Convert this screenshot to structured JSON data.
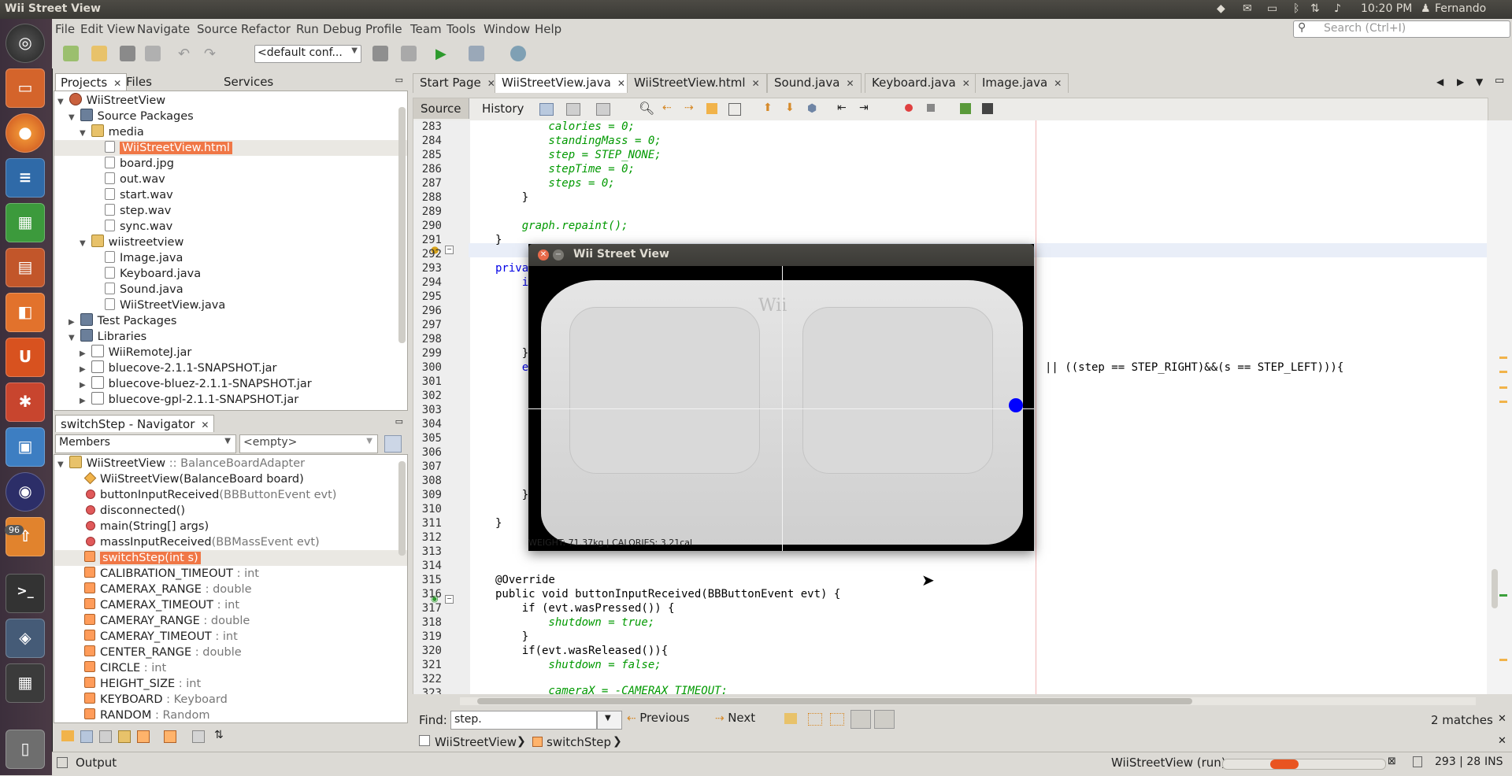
{
  "window": {
    "title": "Wii Street View"
  },
  "tray": {
    "time": "10:20 PM",
    "user": "Fernando"
  },
  "launcher": {
    "badge": "96"
  },
  "menu": [
    "File",
    "Edit",
    "View",
    "Navigate",
    "Source",
    "Refactor",
    "Run",
    "Debug",
    "Profile",
    "Team",
    "Tools",
    "Window",
    "Help"
  ],
  "search": {
    "placeholder": "Search (Ctrl+I)"
  },
  "toolbar": {
    "config": "<default conf..."
  },
  "projects_panel": {
    "tabs": [
      "Projects",
      "Files",
      "Services"
    ],
    "tree": [
      {
        "label": "WiiStreetView"
      },
      {
        "label": "Source Packages"
      },
      {
        "label": "media"
      },
      {
        "label": "WiiStreetView.html"
      },
      {
        "label": "board.jpg"
      },
      {
        "label": "out.wav"
      },
      {
        "label": "start.wav"
      },
      {
        "label": "step.wav"
      },
      {
        "label": "sync.wav"
      },
      {
        "label": "wiistreetview"
      },
      {
        "label": "Image.java"
      },
      {
        "label": "Keyboard.java"
      },
      {
        "label": "Sound.java"
      },
      {
        "label": "WiiStreetView.java"
      },
      {
        "label": "Test Packages"
      },
      {
        "label": "Libraries"
      },
      {
        "label": "WiiRemoteJ.jar"
      },
      {
        "label": "bluecove-2.1.1-SNAPSHOT.jar"
      },
      {
        "label": "bluecove-bluez-2.1.1-SNAPSHOT.jar"
      },
      {
        "label": "bluecove-gpl-2.1.1-SNAPSHOT.jar"
      }
    ]
  },
  "navigator": {
    "title": "switchStep - Navigator",
    "members_label": "Members",
    "filter_value": "<empty>",
    "class_name": "WiiStreetView",
    "class_super": " :: BalanceBoardAdapter",
    "members": [
      {
        "name": "WiiStreetView",
        "sig": "(BalanceBoard board)"
      },
      {
        "name": "buttonInputReceived",
        "sig": "(BBButtonEvent evt)"
      },
      {
        "name": "disconnected",
        "sig": "()"
      },
      {
        "name": "main",
        "sig": "(String[] args)"
      },
      {
        "name": "massInputReceived",
        "sig": "(BBMassEvent evt)"
      },
      {
        "name": "switchStep(int s)",
        "sig": ""
      },
      {
        "name": "CALIBRATION_TIMEOUT",
        "sig": " : int"
      },
      {
        "name": "CAMERAX_RANGE",
        "sig": " : double"
      },
      {
        "name": "CAMERAX_TIMEOUT",
        "sig": " : int"
      },
      {
        "name": "CAMERAY_RANGE",
        "sig": " : double"
      },
      {
        "name": "CAMERAY_TIMEOUT",
        "sig": " : int"
      },
      {
        "name": "CENTER_RANGE",
        "sig": " : double"
      },
      {
        "name": "CIRCLE",
        "sig": " : int"
      },
      {
        "name": "HEIGHT_SIZE",
        "sig": " : int"
      },
      {
        "name": "KEYBOARD",
        "sig": " : Keyboard"
      },
      {
        "name": "RANDOM",
        "sig": " : Random"
      }
    ]
  },
  "editor": {
    "tabs": [
      "Start Page",
      "WiiStreetView.java",
      "WiiStreetView.html",
      "Sound.java",
      "Keyboard.java",
      "Image.java"
    ],
    "source_label": "Source",
    "history_label": "History",
    "line_numbers": [
      "283",
      "284",
      "285",
      "286",
      "287",
      "288",
      "289",
      "290",
      "291",
      "292",
      "293",
      "294",
      "295",
      "296",
      "297",
      "298",
      "299",
      "300",
      "301",
      "302",
      "303",
      "304",
      "305",
      "306",
      "307",
      "308",
      "309",
      "310",
      "311",
      "312",
      "313",
      "314",
      "315",
      "316",
      "317",
      "318",
      "319",
      "320",
      "321",
      "322",
      "323"
    ],
    "code": {
      "l283": "        calories = 0;",
      "l284": "        standingMass = 0;",
      "l285": "        step = STEP_NONE;",
      "l286": "        stepTime = 0;",
      "l287": "        steps = 0;",
      "l288": "    }",
      "l290": "    graph.repaint();",
      "l291": "}",
      "l293": "priva",
      "l294": "    i",
      "l299": "    }",
      "l300a": "    e",
      "l300b": "|| ((step == STEP_RIGHT)&&(s == STEP_LEFT))){",
      "l309": "    }",
      "l311": "}",
      "l315": "@Override",
      "l316": "public void buttonInputReceived(BBButtonEvent evt) {",
      "l317": "    if (evt.wasPressed()) {",
      "l318": "        shutdown = true;",
      "l319": "    }",
      "l320": "    if(evt.wasReleased()){",
      "l321": "        shutdown = false;",
      "l323": "        cameraX = -CAMERAX_TIMEOUT;"
    }
  },
  "wii_window": {
    "title": "Wii Street View",
    "status": "WEIGHT: 71.37kg | CALORIES: 3.21cal",
    "board_logo": "Wii",
    "indicator_color": "#0000ff"
  },
  "find": {
    "label": "Find:",
    "value": "step.",
    "previous": "Previous",
    "next": "Next",
    "matches": "2 matches"
  },
  "breadcrumb": [
    "WiiStreetView",
    "switchStep"
  ],
  "status": {
    "output": "Output",
    "running": "WiiStreetView (run)",
    "position": "293 | 28",
    "mode": "INS"
  },
  "colors": {
    "selection": "#f07746",
    "accent": "#e95420"
  }
}
